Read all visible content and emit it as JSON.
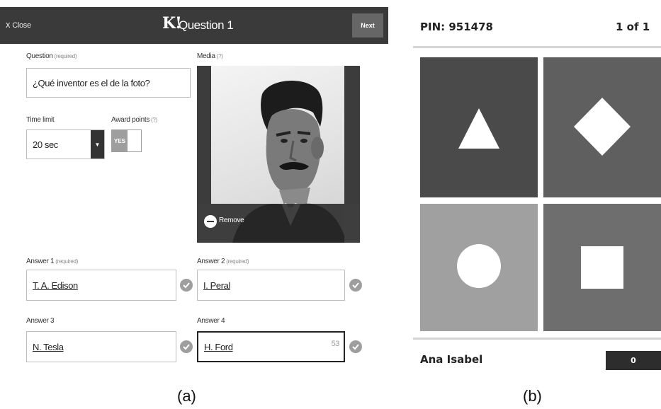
{
  "editor": {
    "close_label": "Close",
    "close_icon": "x",
    "logo_text": "K!",
    "title": "Question 1",
    "next_label": "Next",
    "question": {
      "label": "Question",
      "required": "(required)",
      "value": "¿Qué inventor es el de la foto?"
    },
    "time_limit": {
      "label": "Time limit",
      "value": "20 sec"
    },
    "award": {
      "label": "Award points",
      "hint": "(?)",
      "toggle_value": "YES"
    },
    "media": {
      "label": "Media",
      "hint": "(?)",
      "remove_label": "Remove"
    },
    "answers": [
      {
        "label": "Answer 1",
        "required": "(required)",
        "value": "T. A. Edison"
      },
      {
        "label": "Answer 2",
        "required": "(required)",
        "value": "I. Peral"
      },
      {
        "label": "Answer 3",
        "required": "",
        "value": "N. Tesla"
      },
      {
        "label": "Answer 4",
        "required": "",
        "value": "H. Ford",
        "counter": "53"
      }
    ]
  },
  "player": {
    "pin_label": "PIN: 951478",
    "progress": "1 of 1",
    "tiles": [
      {
        "shape": "triangle",
        "color": "#4a4a4a"
      },
      {
        "shape": "diamond",
        "color": "#5f5f5f"
      },
      {
        "shape": "circle",
        "color": "#a0a0a0"
      },
      {
        "shape": "square",
        "color": "#6e6e6e"
      }
    ],
    "name": "Ana Isabel",
    "score": "0"
  },
  "captions": {
    "a": "(a)",
    "b": "(b)"
  }
}
